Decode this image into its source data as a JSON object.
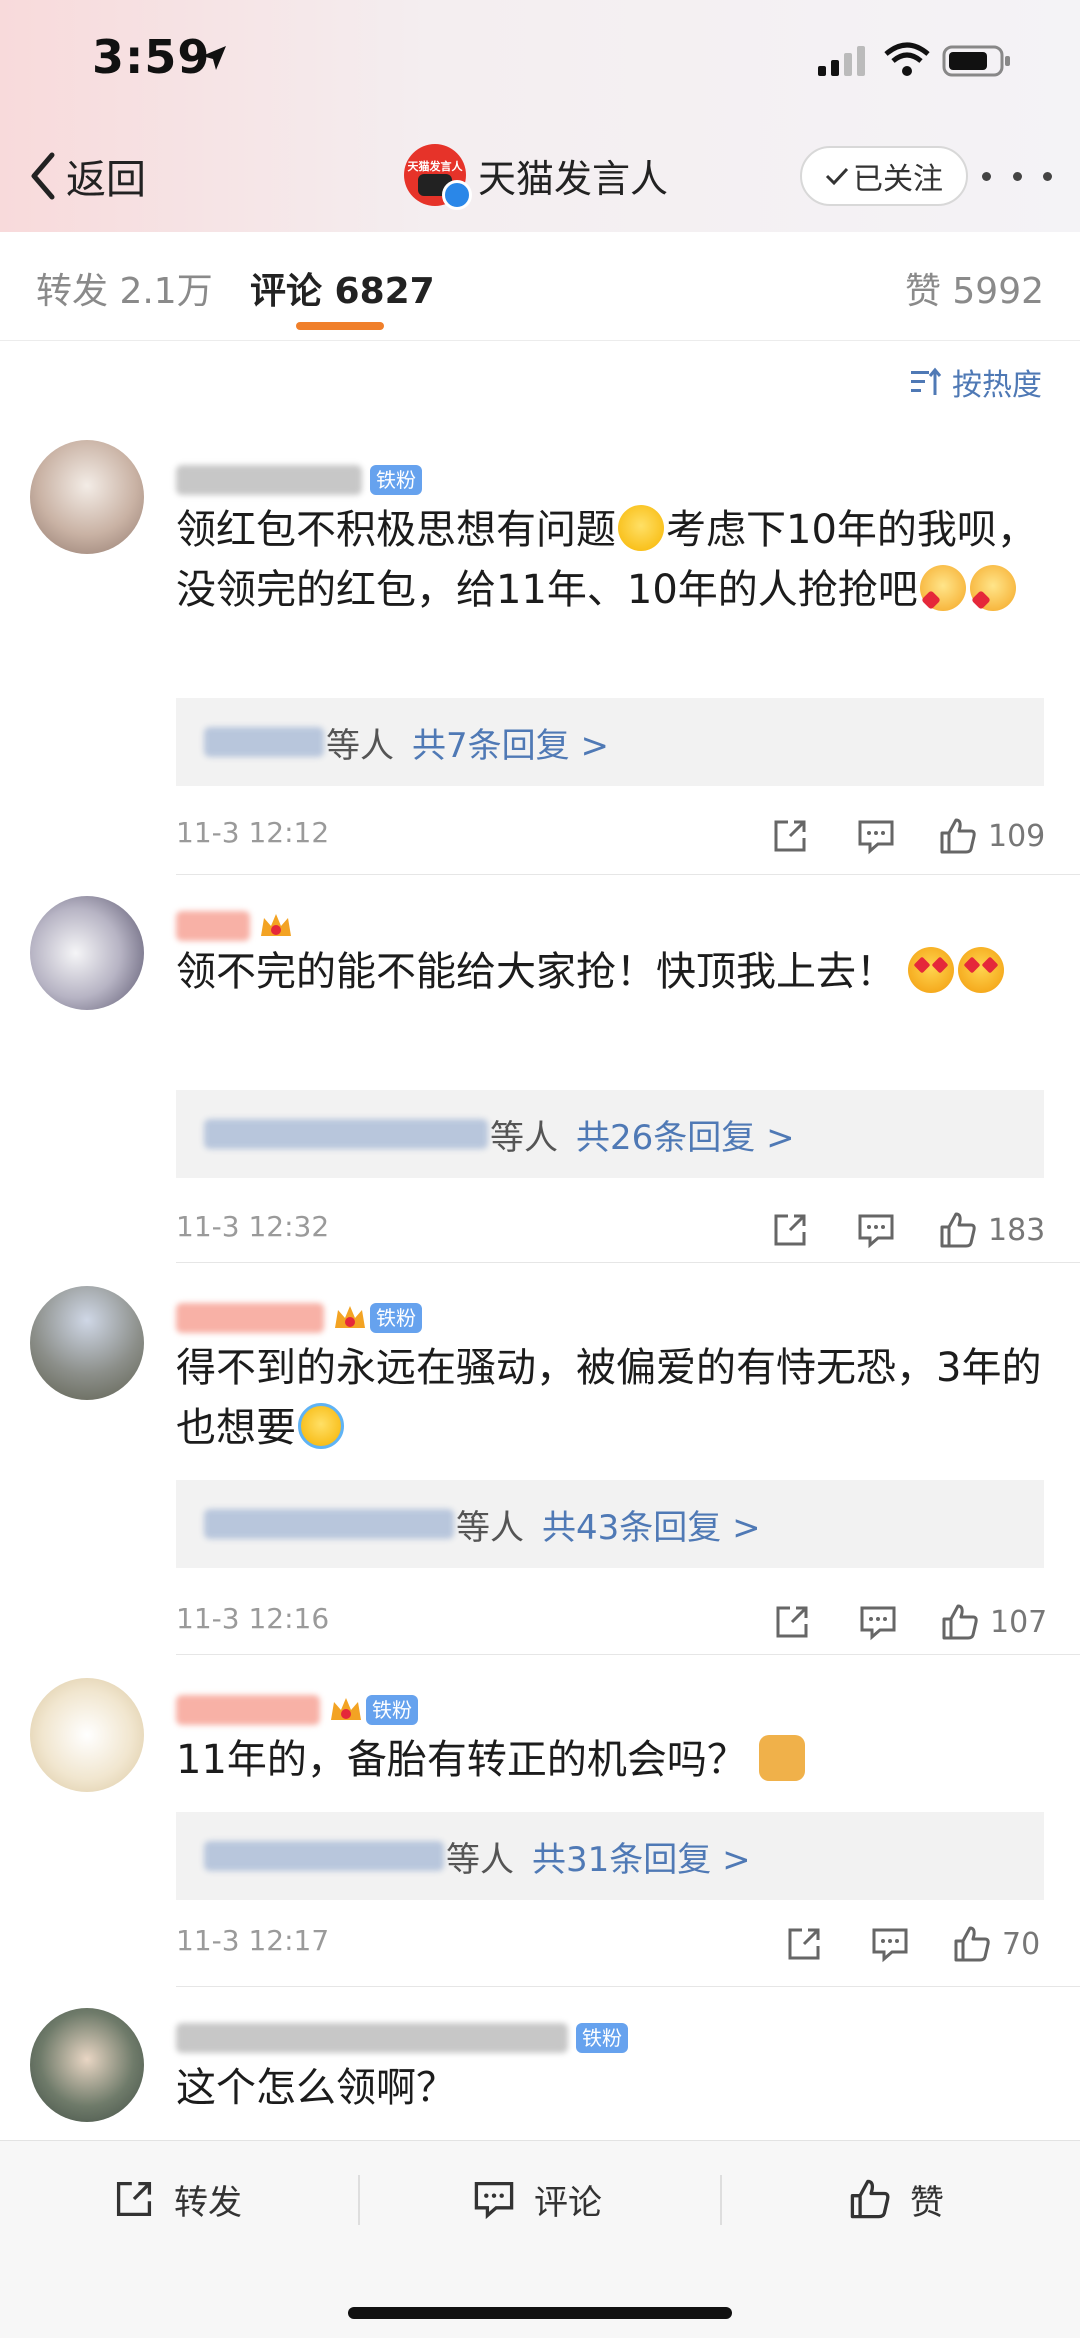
{
  "status_bar": {
    "time": "3:59"
  },
  "nav": {
    "back_label": "返回",
    "avatar_text": "天猫发言人",
    "title": "天猫发言人",
    "follow_label": "已关注"
  },
  "tabs": {
    "repost": "转发 2.1万",
    "comment": "评论 6827",
    "like": "赞 5992"
  },
  "sort_label": "按热度",
  "comments": [
    {
      "badge": "铁粉",
      "text1": "领红包不积极思想有问题",
      "text2": "考虑下10年的我呗，没领完的红包，给11年、10年的人抢抢吧",
      "reply_mid": "等人",
      "reply_count": "共7条回复 >",
      "time": "11-3 12:12",
      "likes": "109"
    },
    {
      "text1": "领不完的能不能给大家抢！快顶我上去！",
      "reply_mid": "等人",
      "reply_count": "共26条回复 >",
      "time": "11-3 12:32",
      "likes": "183"
    },
    {
      "badge": "铁粉",
      "text1": "得不到的永远在骚动，被偏爱的有恃无恐，3年的也想要",
      "reply_mid": "等人",
      "reply_count": "共43条回复 >",
      "time": "11-3 12:16",
      "likes": "107"
    },
    {
      "badge": "铁粉",
      "text1": "11年的，备胎有转正的机会吗？",
      "reply_mid": "等人",
      "reply_count": "共31条回复 >",
      "time": "11-3 12:17",
      "likes": "70"
    },
    {
      "badge": "铁粉",
      "text1": "这个怎么领啊？"
    }
  ],
  "bottom_bar": {
    "repost": "转发",
    "comment": "评论",
    "like": "赞"
  },
  "colors": {
    "accent": "#f07f2a",
    "link": "#4f79b5",
    "fan_badge": "#66a2ee"
  }
}
